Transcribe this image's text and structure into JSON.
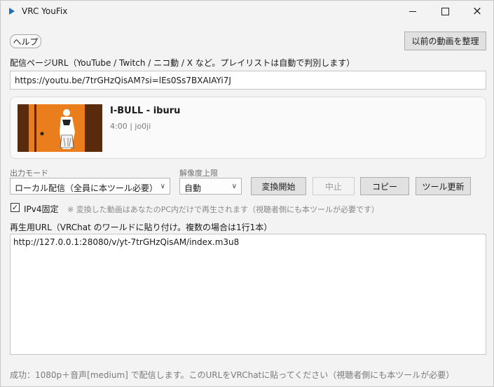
{
  "window": {
    "title": "VRC YouFix",
    "icon": "play-icon",
    "controls": {
      "minimize": "minimize-icon",
      "maximize": "maximize-icon",
      "close": "×"
    }
  },
  "toolbar": {
    "help_label": "ヘルプ",
    "organize_label": "以前の動画を整理"
  },
  "url_section": {
    "label": "配信ページURL（YouTube / Twitch / ニコ動 / X など。プレイリストは自動で判別します）",
    "value": "https://youtu.be/7trGHzQisAM?si=lEs0Ss7BXAIAYi7J"
  },
  "video": {
    "title": "I-BULL - iburu",
    "meta": "4:00 | jo0ji",
    "thumbnail_colors": {
      "background": "#ea7d1c",
      "bars": "#5a2a0d"
    }
  },
  "output_mode": {
    "label": "出力モード",
    "selected": "ローカル配信（全員に本ツール必要）"
  },
  "resolution": {
    "label": "解像度上限",
    "selected": "自動"
  },
  "actions": {
    "start_label": "変換開始",
    "stop_label": "中止",
    "copy_label": "コピー",
    "update_label": "ツール更新"
  },
  "ipv4": {
    "checked": true,
    "label": "IPv4固定",
    "note": "※ 変換した動画はあなたのPC内だけで再生されます（視聴者側にも本ツールが必要です）"
  },
  "playback": {
    "label": "再生用URL（VRChat のワールドに貼り付け。複数の場合は1行1本）",
    "value": "http://127.0.0.1:28080/v/yt-7trGHzQisAM/index.m3u8"
  },
  "status": "成功：1080p＋音声[medium] で配信します。このURLをVRChatに貼ってください（視聴者側にも本ツールが必要）"
}
